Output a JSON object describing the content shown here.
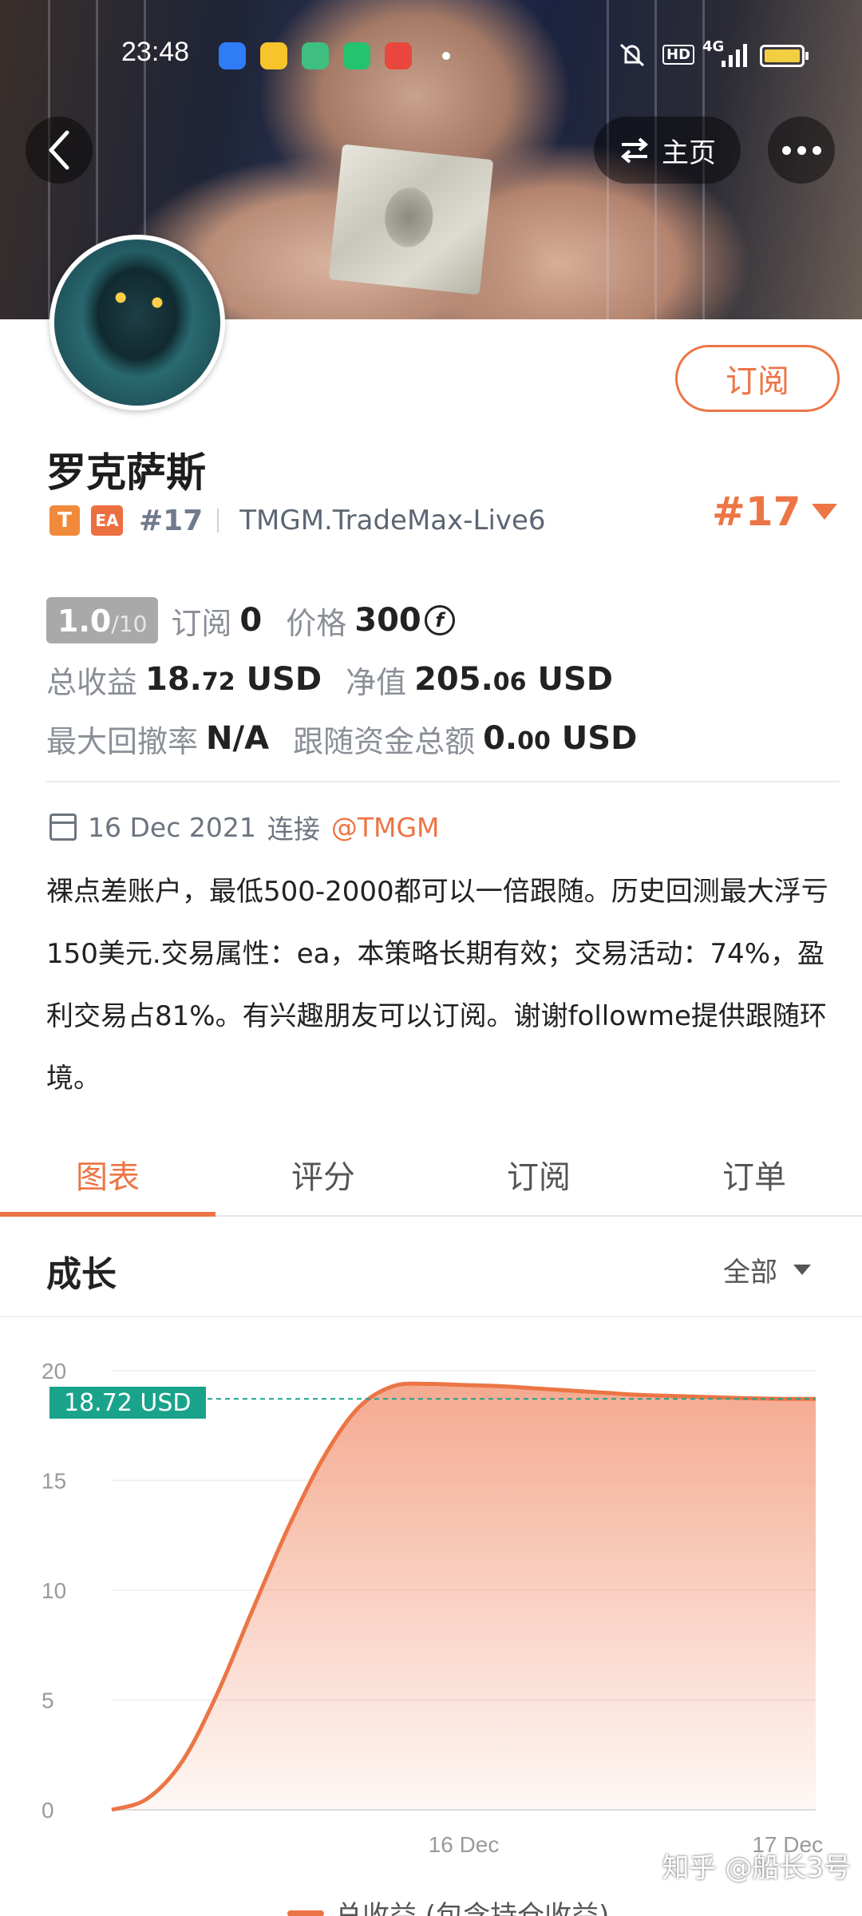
{
  "status_bar": {
    "time": "23:48",
    "network": "4G",
    "hd": "HD",
    "apps": [
      "app-blue",
      "app-yellow",
      "app-green",
      "app-green2",
      "app-red"
    ],
    "colors": [
      "#2f7cf6",
      "#f7c52b",
      "#3fbf7f",
      "#23c36f",
      "#e9473e"
    ]
  },
  "nav": {
    "back_icon": "chevron-left-icon",
    "home_label": "主页",
    "home_icon": "swap-icon",
    "more_icon": "more-dots-icon"
  },
  "profile": {
    "name": "罗克萨斯",
    "subscribe_label": "订阅",
    "badges": [
      "T",
      "EA"
    ],
    "rank": "#17",
    "server": "TMGM.TradeMax-Live6",
    "rank_big": "#17"
  },
  "stats": {
    "score": "1.0",
    "score_max": "/10",
    "subscribe_label": "订阅",
    "subscribe_count": "0",
    "price_label": "价格",
    "price_value": "300",
    "coin_symbol": "f",
    "total_profit_label": "总收益",
    "total_profit_int": "18.",
    "total_profit_dec": "72",
    "total_profit_unit": "USD",
    "equity_label": "净值",
    "equity_int": "205.",
    "equity_dec": "06",
    "equity_unit": "USD",
    "drawdown_label": "最大回撤率",
    "drawdown_value": "N/A",
    "follow_funds_label": "跟随资金总额",
    "follow_funds_int": "0.",
    "follow_funds_dec": "00",
    "follow_funds_unit": "USD"
  },
  "connect": {
    "date": "16 Dec 2021",
    "verb": "连接",
    "broker": "@TMGM"
  },
  "description": "裸点差账户，最低500-2000都可以一倍跟随。历史回测最大浮亏150美元.交易属性：ea，本策略长期有效；交易活动：74%，盈利交易占81%。有兴趣朋友可以订阅。谢谢followme提供跟随环境。",
  "tabs": [
    {
      "label": "图表",
      "active": true
    },
    {
      "label": "评分",
      "active": false
    },
    {
      "label": "订阅",
      "active": false
    },
    {
      "label": "订单",
      "active": false
    }
  ],
  "section": {
    "title": "成长",
    "range_label": "全部"
  },
  "chart_data": {
    "type": "area",
    "y_ticks": [
      "0",
      "5",
      "10",
      "15",
      "20"
    ],
    "ylim": [
      0,
      20
    ],
    "x_ticks": [
      "16 Dec",
      "17 Dec"
    ],
    "x": [
      0,
      0.05,
      0.1,
      0.15,
      0.2,
      0.25,
      0.3,
      0.35,
      0.4,
      0.45,
      0.5,
      0.55,
      0.6,
      0.65,
      0.7,
      0.75,
      0.8,
      0.85,
      0.9,
      0.95,
      1.0
    ],
    "values": [
      0,
      0.5,
      2.2,
      5.3,
      9.1,
      12.8,
      16.0,
      18.3,
      19.3,
      19.4,
      19.35,
      19.3,
      19.2,
      19.1,
      19.0,
      18.9,
      18.85,
      18.8,
      18.75,
      18.72,
      18.72
    ],
    "current_label": "18.72 USD",
    "current_value": 18.72,
    "series_name": "总收益 (包含持仓收益)",
    "line_color": "#ec7545",
    "fill_color": "#f4a58a",
    "marker_color": "#1aa38b",
    "grid": true
  },
  "watermark": "知乎 @船长3号"
}
